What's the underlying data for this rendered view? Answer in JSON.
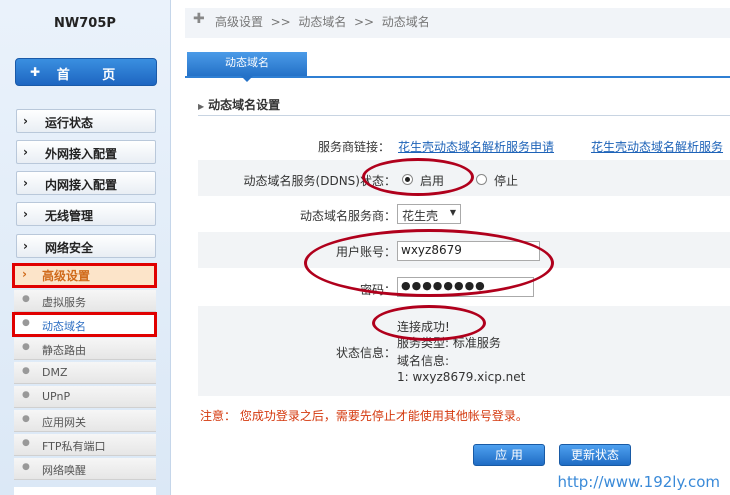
{
  "sidebar": {
    "model": "NW705P",
    "home_label": "首 页",
    "menu": [
      {
        "label": "运行状态"
      },
      {
        "label": "外网接入配置"
      },
      {
        "label": "内网接入配置"
      },
      {
        "label": "无线管理"
      },
      {
        "label": "网络安全"
      }
    ],
    "advanced_label": "高级设置",
    "submenu": [
      {
        "label": "虚拟服务"
      },
      {
        "label": "动态域名"
      },
      {
        "label": "静态路由"
      },
      {
        "label": "DMZ"
      },
      {
        "label": "UPnP"
      },
      {
        "label": "应用网关"
      },
      {
        "label": "FTP私有端口"
      },
      {
        "label": "网络唤醒"
      }
    ]
  },
  "breadcrumb": "高级设置  >>  动态域名  >>  动态域名",
  "tab_label": "动态域名",
  "section_title": "动态域名设置",
  "form": {
    "provider_link_label": "服务商链接：",
    "provider_link_1": "花生壳动态域名解析服务申请",
    "provider_link_2": "花生壳动态域名解析服务",
    "ddns_label": "动态域名服务(DDNS)状态：",
    "ddns_on": "启用",
    "ddns_off": "停止",
    "provider_label": "动态域名服务商：",
    "provider_value": "花生壳",
    "user_label": "用户账号：",
    "user_value": "wxyz8679",
    "password_label": "密码：",
    "password_value": "●●●●●●●●",
    "status_label": "状态信息：",
    "status_lines": {
      "l1": "连接成功!",
      "l2": "服务类型: 标准服务",
      "l3": "域名信息:",
      "l4": "1: wxyz8679.xicp.net"
    }
  },
  "note": "注意：  您成功登录之后，需要先停止才能使用其他帐号登录。",
  "buttons": {
    "apply": "应  用",
    "refresh": "更新状态"
  },
  "watermark": "http://www.192ly.com"
}
